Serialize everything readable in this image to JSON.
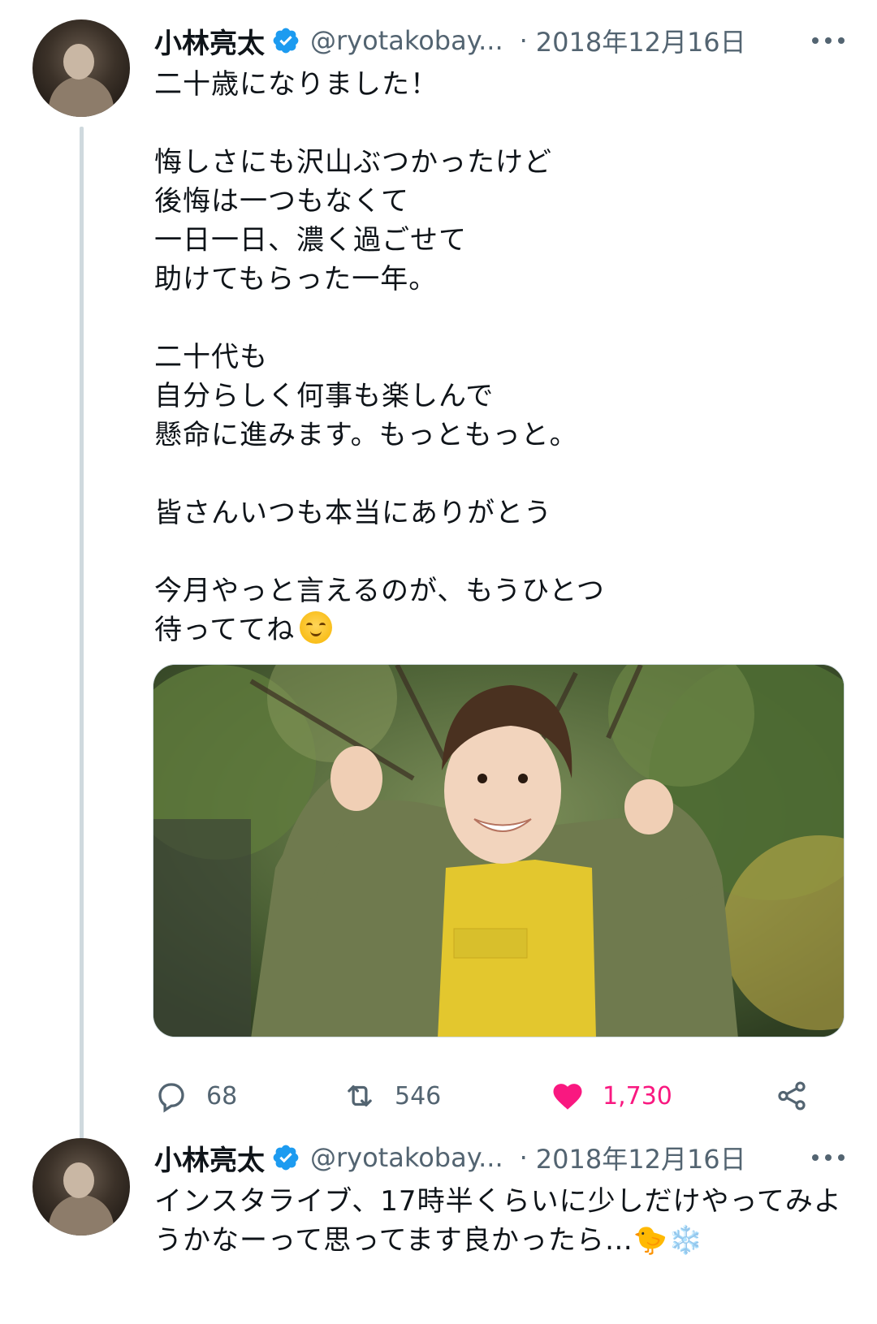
{
  "tweets": [
    {
      "author_name": "小林亮太",
      "handle": "@ryotakobay...",
      "separator": "·",
      "date": "2018年12月16日",
      "text_lines": [
        "二十歳になりました！",
        "",
        "悔しさにも沢山ぶつかったけど",
        "後悔は一つもなくて",
        "一日一日、濃く過ごせて",
        "助けてもらった一年。",
        "",
        "二十代も",
        "自分らしく何事も楽しんで",
        "懸命に進みます。もっともっと。",
        "",
        "皆さんいつも本当にありがとう",
        "",
        "今月やっと言えるのが、もうひとつ",
        "待っててね"
      ],
      "text_emoji": "smiling-face-with-smiling-eyes",
      "media": {
        "type": "photo",
        "description_icon": "photo-icon"
      },
      "actions": {
        "reply_count": "68",
        "retweet_count": "546",
        "like_count": "1,730"
      },
      "liked": true
    },
    {
      "author_name": "小林亮太",
      "handle": "@ryotakobay...",
      "separator": "·",
      "date": "2018年12月16日",
      "text_lines": [
        "インスタライブ、17時半くらいに少しだけやってみよ",
        "うかなーって思ってます良かったら…🐤❄️"
      ]
    }
  ],
  "colors": {
    "text_primary": "#0f1419",
    "text_secondary": "#536471",
    "verified_blue": "#1d9bf0",
    "like_pink": "#f91880",
    "thread_line": "#cfd9de"
  }
}
